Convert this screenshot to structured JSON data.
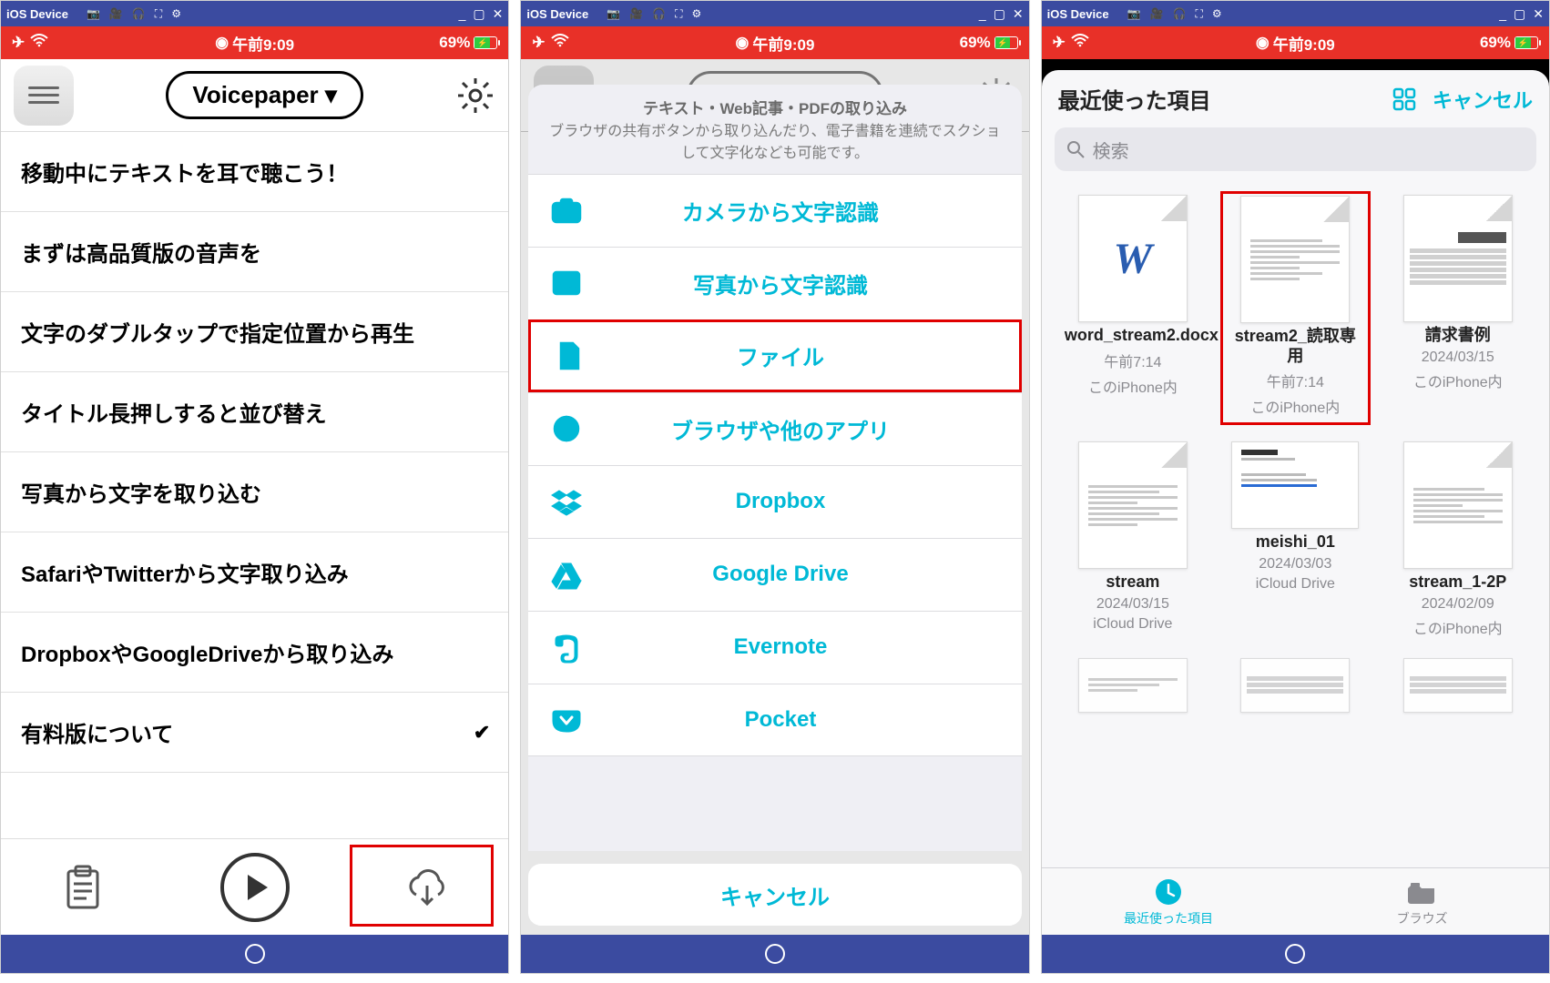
{
  "window": {
    "title": "iOS Device",
    "controls": {
      "min": "_",
      "max": "▢",
      "close": "✕"
    }
  },
  "statusbar": {
    "time": "午前9:09",
    "battery": "69%"
  },
  "screen1": {
    "title": "Voicepaper ▾",
    "items": [
      "移動中にテキストを耳で聴こう！",
      "まずは高品質版の音声を",
      "文字のダブルタップで指定位置から再生",
      "タイトル長押しすると並び替え",
      "写真から文字を取り込む",
      "SafariやTwitterから文字取り込み",
      "DropboxやGoogleDriveから取り込み",
      "有料版について"
    ]
  },
  "screen2": {
    "sheet_title": "テキスト・Web記事・PDFの取り込み",
    "sheet_sub": "ブラウザの共有ボタンから取り込んだり、電子書籍を連続でスクショして文字化なども可能です。",
    "rows": [
      "カメラから文字認識",
      "写真から文字認識",
      "ファイル",
      "ブラウザや他のアプリ",
      "Dropbox",
      "Google Drive",
      "Evernote",
      "Pocket"
    ],
    "cancel": "キャンセル"
  },
  "screen3": {
    "title": "最近使った項目",
    "cancel": "キャンセル",
    "search_placeholder": "検索",
    "files": [
      {
        "name": "word_stream2.docx",
        "date": "午前7:14",
        "loc": "このiPhone内",
        "thumb": "word"
      },
      {
        "name": "stream2_読取専用",
        "date": "午前7:14",
        "loc": "このiPhone内",
        "thumb": "doc",
        "highlight": true
      },
      {
        "name": "請求書例",
        "date": "2024/03/15",
        "loc": "このiPhone内",
        "thumb": "table"
      },
      {
        "name": "stream",
        "date": "2024/03/15",
        "loc": "iCloud Drive",
        "thumb": "doc"
      },
      {
        "name": "meishi_01",
        "date": "2024/03/03",
        "loc": "iCloud Drive",
        "thumb": "bizcard"
      },
      {
        "name": "stream_1-2P",
        "date": "2024/02/09",
        "loc": "このiPhone内",
        "thumb": "doc"
      }
    ],
    "tabs": {
      "recent": "最近使った項目",
      "browse": "ブラウズ"
    }
  }
}
